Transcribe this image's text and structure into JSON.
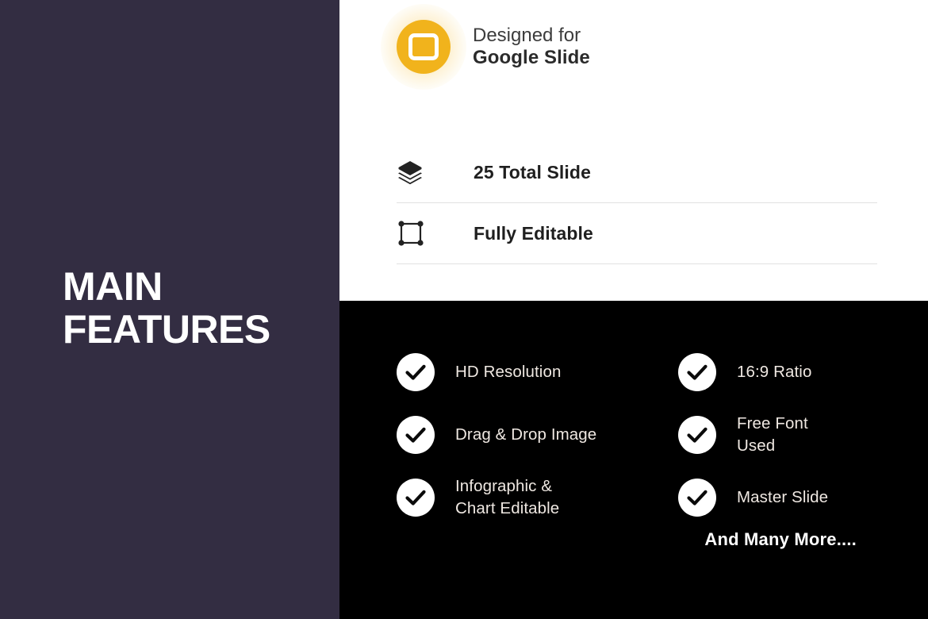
{
  "left": {
    "title": "MAIN\nFEATURES",
    "background_color": "#332D42"
  },
  "white_section": {
    "background_color": "#FFFFFF",
    "designed": {
      "icon": "google-slides-icon",
      "icon_color": "#F1B31C",
      "line1": "Designed for",
      "line2": "Google Slide"
    },
    "features": [
      {
        "icon": "layers-icon",
        "label": "25 Total Slide"
      },
      {
        "icon": "bounding-box-icon",
        "label": "Fully Editable"
      }
    ],
    "divider_color": "#E2E2E2"
  },
  "black_section": {
    "background_color": "#000000",
    "text_color": "#EFE8E2",
    "left_column": [
      {
        "icon": "check-circle-icon",
        "label": "HD Resolution"
      },
      {
        "icon": "check-circle-icon",
        "label": "Drag & Drop Image"
      },
      {
        "icon": "check-circle-icon",
        "label": "Infographic &\nChart Editable"
      }
    ],
    "right_column": [
      {
        "icon": "check-circle-icon",
        "label": "16:9 Ratio"
      },
      {
        "icon": "check-circle-icon",
        "label": "Free Font\nUsed"
      },
      {
        "icon": "check-circle-icon",
        "label": "Master Slide"
      }
    ],
    "footer_note": "And Many More...."
  }
}
